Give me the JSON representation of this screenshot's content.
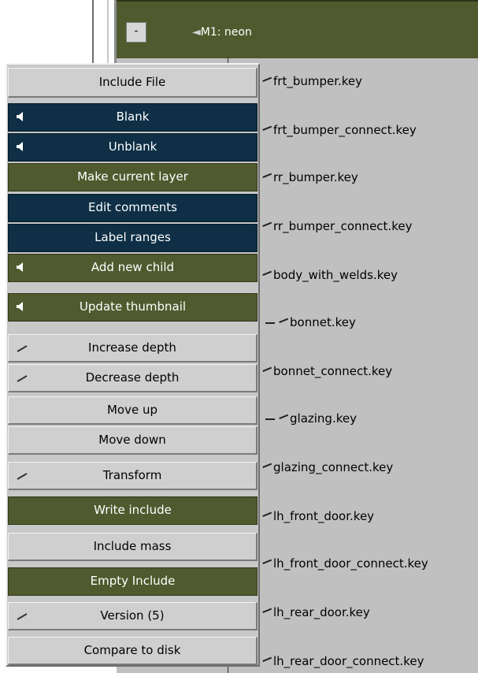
{
  "tree": {
    "root": {
      "prefix": "◄",
      "label": "M1: neon",
      "collapse_symbol": "-"
    },
    "items": [
      "frt_bumper.key",
      "frt_bumper_connect.key",
      "rr_bumper.key",
      "rr_bumper_connect.key",
      "body_with_welds.key",
      "bonnet.key",
      "bonnet_connect.key",
      "glazing.key",
      "glazing_connect.key",
      "lh_front_door.key",
      "lh_front_door_connect.key",
      "lh_rear_door.key",
      "lh_rear_door_connect.key"
    ]
  },
  "menu": {
    "items": [
      {
        "label": "Include File",
        "style": "light",
        "icon": null
      },
      {
        "label": "Blank",
        "style": "navy",
        "icon": "speaker-icon"
      },
      {
        "label": "Unblank",
        "style": "navy",
        "icon": "speaker-icon"
      },
      {
        "label": "Make current layer",
        "style": "olive",
        "icon": null
      },
      {
        "label": "Edit comments",
        "style": "navy",
        "icon": null
      },
      {
        "label": "Label ranges",
        "style": "navy",
        "icon": null
      },
      {
        "label": "Add new child",
        "style": "olive",
        "icon": "speaker-icon"
      },
      {
        "label": "Update thumbnail",
        "style": "olive",
        "icon": "speaker-icon"
      },
      {
        "label": "Increase depth",
        "style": "light",
        "icon": "tick-icon"
      },
      {
        "label": "Decrease depth",
        "style": "light",
        "icon": "tick-icon"
      },
      {
        "label": "Move up",
        "style": "light",
        "icon": null
      },
      {
        "label": "Move down",
        "style": "light",
        "icon": null
      },
      {
        "label": "Transform",
        "style": "light",
        "icon": "tick-icon"
      },
      {
        "label": "Write include",
        "style": "olive",
        "icon": null
      },
      {
        "label": "Include mass",
        "style": "light",
        "icon": null
      },
      {
        "label": "Empty Include",
        "style": "olive",
        "icon": null
      },
      {
        "label": "Version (5)",
        "style": "light",
        "icon": "tick-icon"
      },
      {
        "label": "Compare to disk",
        "style": "light",
        "icon": null
      }
    ]
  },
  "colors": {
    "olive": "#4f5a2e",
    "navy": "#0e2f45",
    "panel_gray": "#c0c0c0",
    "button_gray": "#cfcfcf"
  }
}
